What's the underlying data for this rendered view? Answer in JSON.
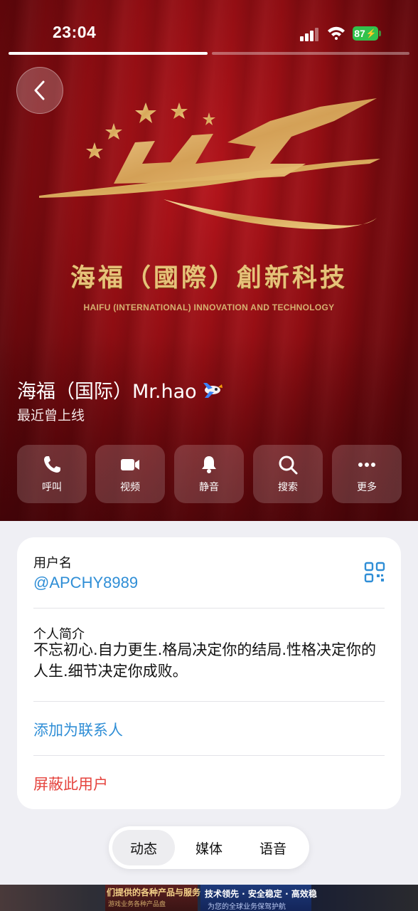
{
  "status_bar": {
    "time": "23:04",
    "battery": "87"
  },
  "header": {
    "brand_cn": "海福（國際）創新科技",
    "brand_en": "HAIFU (INTERNATIONAL) INNOVATION AND TECHNOLOGY",
    "name": "海福（国际）Mr.hao",
    "status": "最近曾上线",
    "colors": {
      "background": "#8e0d12",
      "gold": "#e7c27a"
    }
  },
  "actions": [
    {
      "label": "呼叫",
      "icon": "phone-icon"
    },
    {
      "label": "视频",
      "icon": "video-icon"
    },
    {
      "label": "静音",
      "icon": "bell-icon"
    },
    {
      "label": "搜索",
      "icon": "search-icon"
    },
    {
      "label": "更多",
      "icon": "more-icon"
    }
  ],
  "info": {
    "username_label": "用户名",
    "username": "@APCHY8989",
    "bio_label": "个人简介",
    "bio": "不忘初心.自力更生.格局决定你的结局.性格决定你的人生.细节决定你成败。",
    "add_contact": "添加为联系人",
    "block_user": "屏蔽此用户",
    "colors": {
      "link": "#2f8ed6",
      "danger": "#e5433d"
    }
  },
  "tabs": [
    {
      "label": "动态",
      "active": true
    },
    {
      "label": "媒体",
      "active": false
    },
    {
      "label": "语音",
      "active": false
    }
  ],
  "ad": {
    "left_text": "们提供的各种产品与服务",
    "left_sub": "游戏业务各种产品盘",
    "right_text": "技术领先 · 安全稳定 · 高效稳",
    "right_sub": "为您的全球业务保驾护航"
  }
}
